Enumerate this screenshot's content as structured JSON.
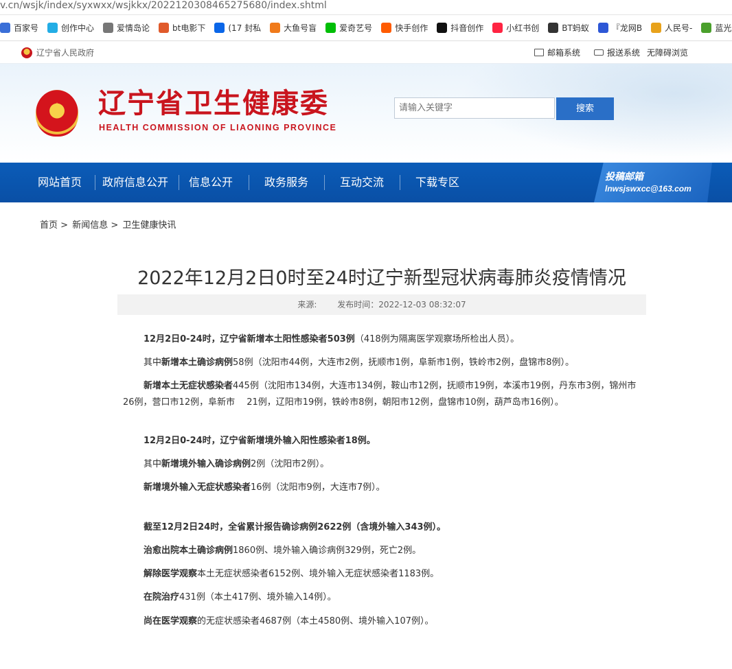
{
  "browser": {
    "url": "v.cn/wsjk/index/syxwxx/wsjkkx/2022120308465275680/index.shtml",
    "bookmarks": [
      {
        "label": "百家号",
        "icon": "baijiahao-icon",
        "color": "#3a6fd8"
      },
      {
        "label": "创作中心",
        "icon": "bilibili-icon",
        "color": "#23ade5"
      },
      {
        "label": "爱情岛论",
        "icon": "globe-icon",
        "color": "#777777"
      },
      {
        "label": "bt电影下",
        "icon": "bt-icon",
        "color": "#e05a2b"
      },
      {
        "label": "(17 封私",
        "icon": "zhihu-icon",
        "color": "#0a66e8"
      },
      {
        "label": "大鱼号盲",
        "icon": "dayu-icon",
        "color": "#f07a1a"
      },
      {
        "label": "爱奇艺号",
        "icon": "iqiyi-icon",
        "color": "#00be06"
      },
      {
        "label": "快手创作",
        "icon": "kuaishou-icon",
        "color": "#ff5b00"
      },
      {
        "label": "抖音创作",
        "icon": "douyin-icon",
        "color": "#111111"
      },
      {
        "label": "小红书创",
        "icon": "xiaohongshu-icon",
        "color": "#ff2442"
      },
      {
        "label": "BT蚂蚁",
        "icon": "ant-icon",
        "color": "#333333"
      },
      {
        "label": "『龙网B",
        "icon": "baidu-icon",
        "color": "#2d57d6"
      },
      {
        "label": "人民号-",
        "icon": "renmin-icon",
        "color": "#e8a21b"
      },
      {
        "label": "蓝光高清",
        "icon": "bluray-icon",
        "color": "#4aa02c"
      }
    ]
  },
  "topbar": {
    "gov_link": "辽宁省人民政府",
    "links": [
      "邮箱系统",
      "报送系统",
      "无障碍浏览"
    ]
  },
  "header": {
    "title": "辽宁省卫生健康委",
    "subtitle": "HEALTH COMMISSION OF LIAONING PROVINCE",
    "search_placeholder": "请输入关键字",
    "search_button": "搜索"
  },
  "nav": {
    "items": [
      "网站首页",
      "政府信息公开",
      "信息公开",
      "政务服务",
      "互动交流",
      "下载专区"
    ],
    "mailbox_title": "投稿邮箱",
    "mailbox_email": "lnwsjswxcc@163.com"
  },
  "breadcrumb": [
    "首页",
    ">",
    "新闻信息",
    ">",
    "卫生健康快讯"
  ],
  "article": {
    "title": "2022年12月2日0时至24时辽宁新型冠状病毒肺炎疫情情况",
    "source_label": "来源:",
    "publish_time": "发布时间：2022-12-03 08:32:07",
    "paragraphs": [
      {
        "bold": "12月2日0-24时，辽宁省新增本土阳性感染者503例",
        "rest": "（418例为隔离医学观察场所检出人员）。"
      },
      {
        "pre": "其中",
        "bold": "新增本土确诊病例",
        "rest": "58例（沈阳市44例，大连市2例，抚顺市1例，阜新市1例，铁岭市2例，盘锦市8例）。"
      },
      {
        "bold": "新增本土无症状感染者",
        "rest": "445例（沈阳市134例，大连市134例，鞍山市12例，抚顺市19例，本溪市19例，丹东市3例，锦州市26例，营口市12例，阜新市　 21例，辽阳市19例，铁岭市8例，朝阳市12例，盘锦市10例，葫芦岛市16例）。"
      },
      {
        "bold": "12月2日0-24时，辽宁省新增境外输入阳性感染者18例。",
        "rest": ""
      },
      {
        "pre": "其中",
        "bold": "新增境外输入确诊病例",
        "rest": "2例（沈阳市2例）。"
      },
      {
        "bold": "新增境外输入无症状感染者",
        "rest": "16例（沈阳市9例，大连市7例）。"
      },
      {
        "bold": "截至12月2日24时，全省累计报告确诊病例2622例（含境外输入343例）。",
        "rest": ""
      },
      {
        "bold": "治愈出院本土确诊病例",
        "rest": "1860例、境外输入确诊病例329例，死亡2例。"
      },
      {
        "bold": "解除医学观察",
        "rest": "本土无症状感染者6152例、境外输入无症状感染者1183例。"
      },
      {
        "bold": "在院治疗",
        "rest": "431例（本土417例、境外输入14例）。"
      },
      {
        "bold": "尚在医学观察",
        "rest": "的无症状感染者4687例（本土4580例、境外输入107例）。"
      }
    ]
  }
}
